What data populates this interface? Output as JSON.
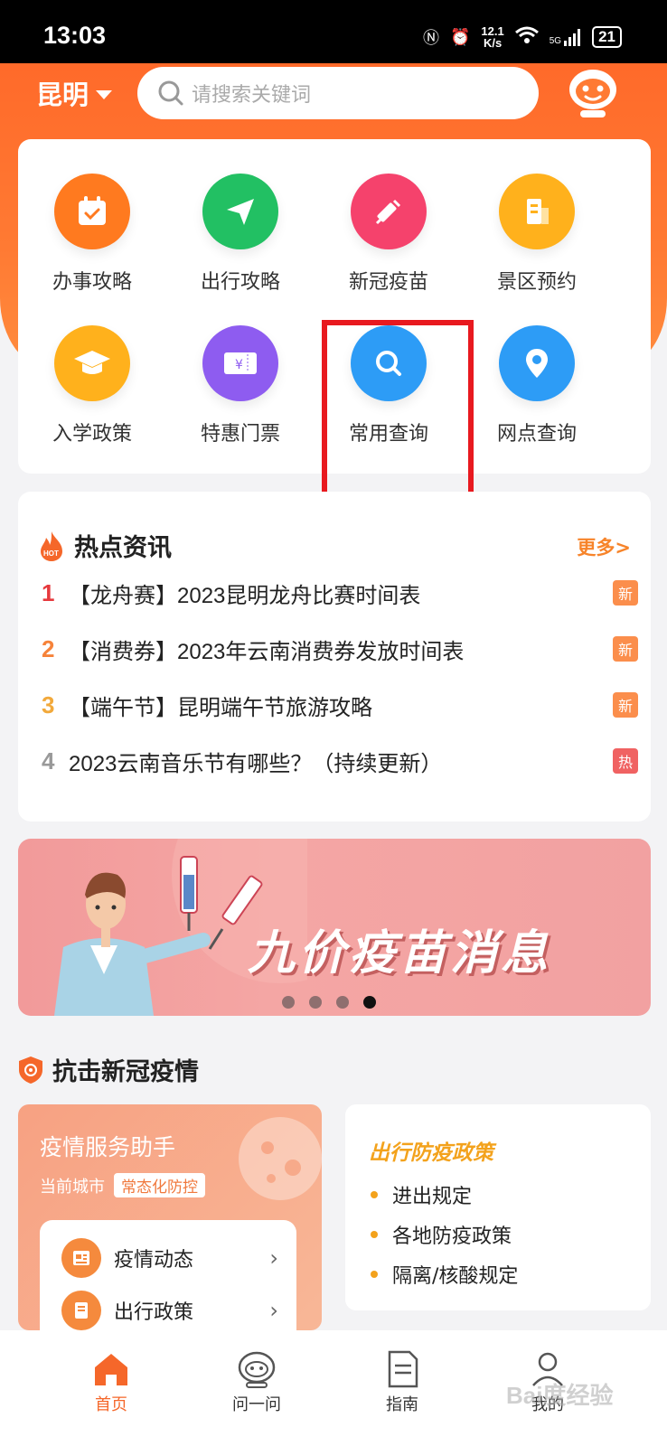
{
  "status_bar": {
    "time": "13:03",
    "net_speed": "12.1",
    "net_unit": "K/s",
    "signal": "5G",
    "battery": "21"
  },
  "header": {
    "city": "昆明",
    "search_placeholder": "请搜索关键词"
  },
  "grid": [
    {
      "label": "办事攻略",
      "icon": "calendar-check-icon",
      "color": "#ff7a1f"
    },
    {
      "label": "出行攻略",
      "icon": "paper-plane-icon",
      "color": "#22c063"
    },
    {
      "label": "新冠疫苗",
      "icon": "syringe-icon",
      "color": "#f5426c"
    },
    {
      "label": "景区预约",
      "icon": "building-icon",
      "color": "#ffb11c"
    },
    {
      "label": "入学政策",
      "icon": "graduation-cap-icon",
      "color": "#ffb11c"
    },
    {
      "label": "特惠门票",
      "icon": "ticket-icon",
      "color": "#8e5cf0"
    },
    {
      "label": "常用查询",
      "icon": "search-icon",
      "color": "#2d9cf6"
    },
    {
      "label": "网点查询",
      "icon": "location-pin-icon",
      "color": "#2d9cf6"
    }
  ],
  "news": {
    "title": "热点资讯",
    "more": "更多>",
    "items": [
      {
        "num": "1",
        "text": "【龙舟赛】2023昆明龙舟比赛时间表",
        "tag": "新",
        "num_color": "#e6393d",
        "tag_color": "#fb8e4c"
      },
      {
        "num": "2",
        "text": "【消费券】2023年云南消费券发放时间表",
        "tag": "新",
        "num_color": "#f6833a",
        "tag_color": "#fb8e4c"
      },
      {
        "num": "3",
        "text": "【端午节】昆明端午节旅游攻略",
        "tag": "新",
        "num_color": "#f2a93b",
        "tag_color": "#fb8e4c"
      },
      {
        "num": "4",
        "text": "2023云南音乐节有哪些？（持续更新）",
        "tag": "热",
        "num_color": "#999999",
        "tag_color": "#f06262"
      }
    ]
  },
  "banner": {
    "title": "九价疫苗消息",
    "active_dot": 4,
    "dot_count": 4
  },
  "covid": {
    "section_title": "抗击新冠疫情",
    "assistant_title": "疫情服务助手",
    "current_city_label": "当前城市",
    "status_pill": "常态化防控",
    "rows": [
      {
        "label": "疫情动态",
        "icon": "news-icon"
      },
      {
        "label": "出行政策",
        "icon": "notebook-icon"
      }
    ],
    "policy_title": "出行防疫政策",
    "policy_items": [
      "进出规定",
      "各地防疫政策",
      "隔离/核酸规定"
    ]
  },
  "tabbar": [
    {
      "label": "首页",
      "icon": "home-icon",
      "active": true
    },
    {
      "label": "问一问",
      "icon": "robot-icon",
      "active": false
    },
    {
      "label": "指南",
      "icon": "document-icon",
      "active": false
    },
    {
      "label": "我的",
      "icon": "user-icon",
      "active": false
    }
  ],
  "watermark": "Bai度经验"
}
